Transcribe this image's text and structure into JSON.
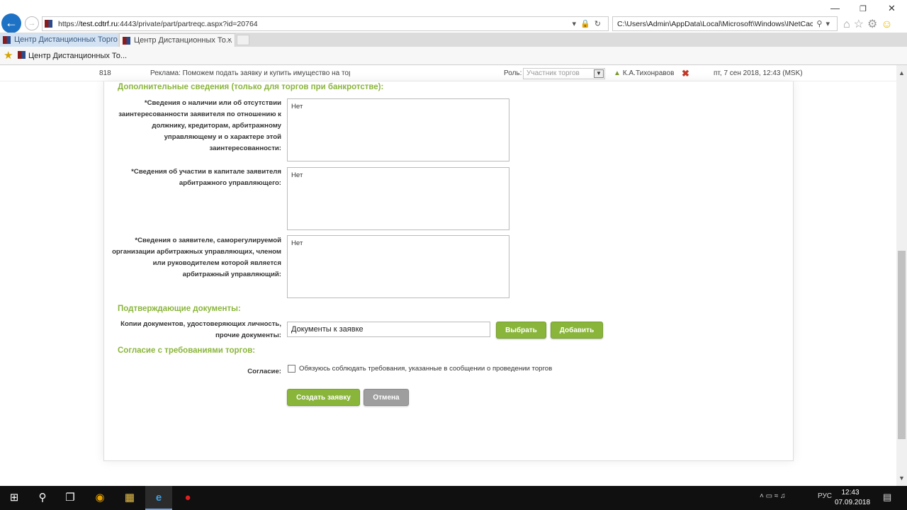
{
  "browser": {
    "url": "https://test.cdtrf.ru:4443/private/part/partreqc.aspx?id=20764",
    "url_host": "test.cdtrf.ru",
    "url_prefix": "https://",
    "url_suffix": ":4443/private/part/partreqc.aspx?id=20764",
    "search_text": "C:\\Users\\Admin\\AppData\\Local\\Microsoft\\Windows\\INetCach",
    "tabs": [
      {
        "label": "Центр Дистанционных Торго..."
      },
      {
        "label": "Центр Дистанционных То...",
        "close": "×"
      }
    ],
    "favorites": [
      {
        "label": "Центр Дистанционных То..."
      }
    ],
    "icons": [
      "back-arrow-icon",
      "forward-arrow-icon",
      "dropdown-icon",
      "lock-icon",
      "refresh-icon",
      "search-icon",
      "home-icon",
      "favorites-star-icon",
      "settings-gear-icon",
      "smiley-feedback-icon"
    ]
  },
  "header": {
    "counter": "818",
    "ad": "Реклама: Поможем подать заявку и купить имущество на торга",
    "role_label": "Роль:",
    "role_value": "Участник торгов",
    "user": "К.А.Тихонравов",
    "date": "пт, 7 сен 2018, 12:43 (MSK)"
  },
  "form": {
    "section_extra": "Дополнительные сведения (только для торгов при банкротстве):",
    "field1_label": [
      "*Сведения о наличии или об отсутствии",
      "заинтересованности заявителя по отношению к",
      "должнику, кредиторам, арбитражному",
      "управляющему и о характере этой",
      "заинтересованности:"
    ],
    "field1_value": "Нет",
    "field2_label": [
      "*Сведения об участии в капитале заявителя",
      "арбитражного управляющего:"
    ],
    "field2_value": "Нет",
    "field3_label": [
      "*Сведения о заявителе, саморегулируемой",
      "организации арбитражных управляющих, членом",
      "или руководителем которой является",
      "арбитражный управляющий:"
    ],
    "field3_value": "Нет",
    "section_docs": "Подтверждающие документы:",
    "docs_label": [
      "Копии документов, удостоверяющих личность,",
      "прочие документы:"
    ],
    "docs_value": "Документы к заявке",
    "btn_choose": "Выбрать",
    "btn_add": "Добавить",
    "section_consent": "Согласие с требованиями торгов:",
    "consent_label": "Согласие:",
    "consent_text": "Обязуюсь соблюдать требования, указанные в сообщении о проведении торгов",
    "consent_checked": false,
    "btn_submit": "Создать заявку",
    "btn_cancel": "Отмена"
  },
  "taskbar": {
    "apps": [
      "windows-start-icon",
      "search-icon",
      "task-view-icon",
      "chrome-icon",
      "file-explorer-icon",
      "internet-explorer-icon",
      "record-icon"
    ],
    "lang": "РУС",
    "time": "12:43",
    "date": "07.09.2018"
  },
  "colors": {
    "accent": "#8ab53b",
    "cancel": "#9e9e9e",
    "taskbar": "#101010"
  }
}
